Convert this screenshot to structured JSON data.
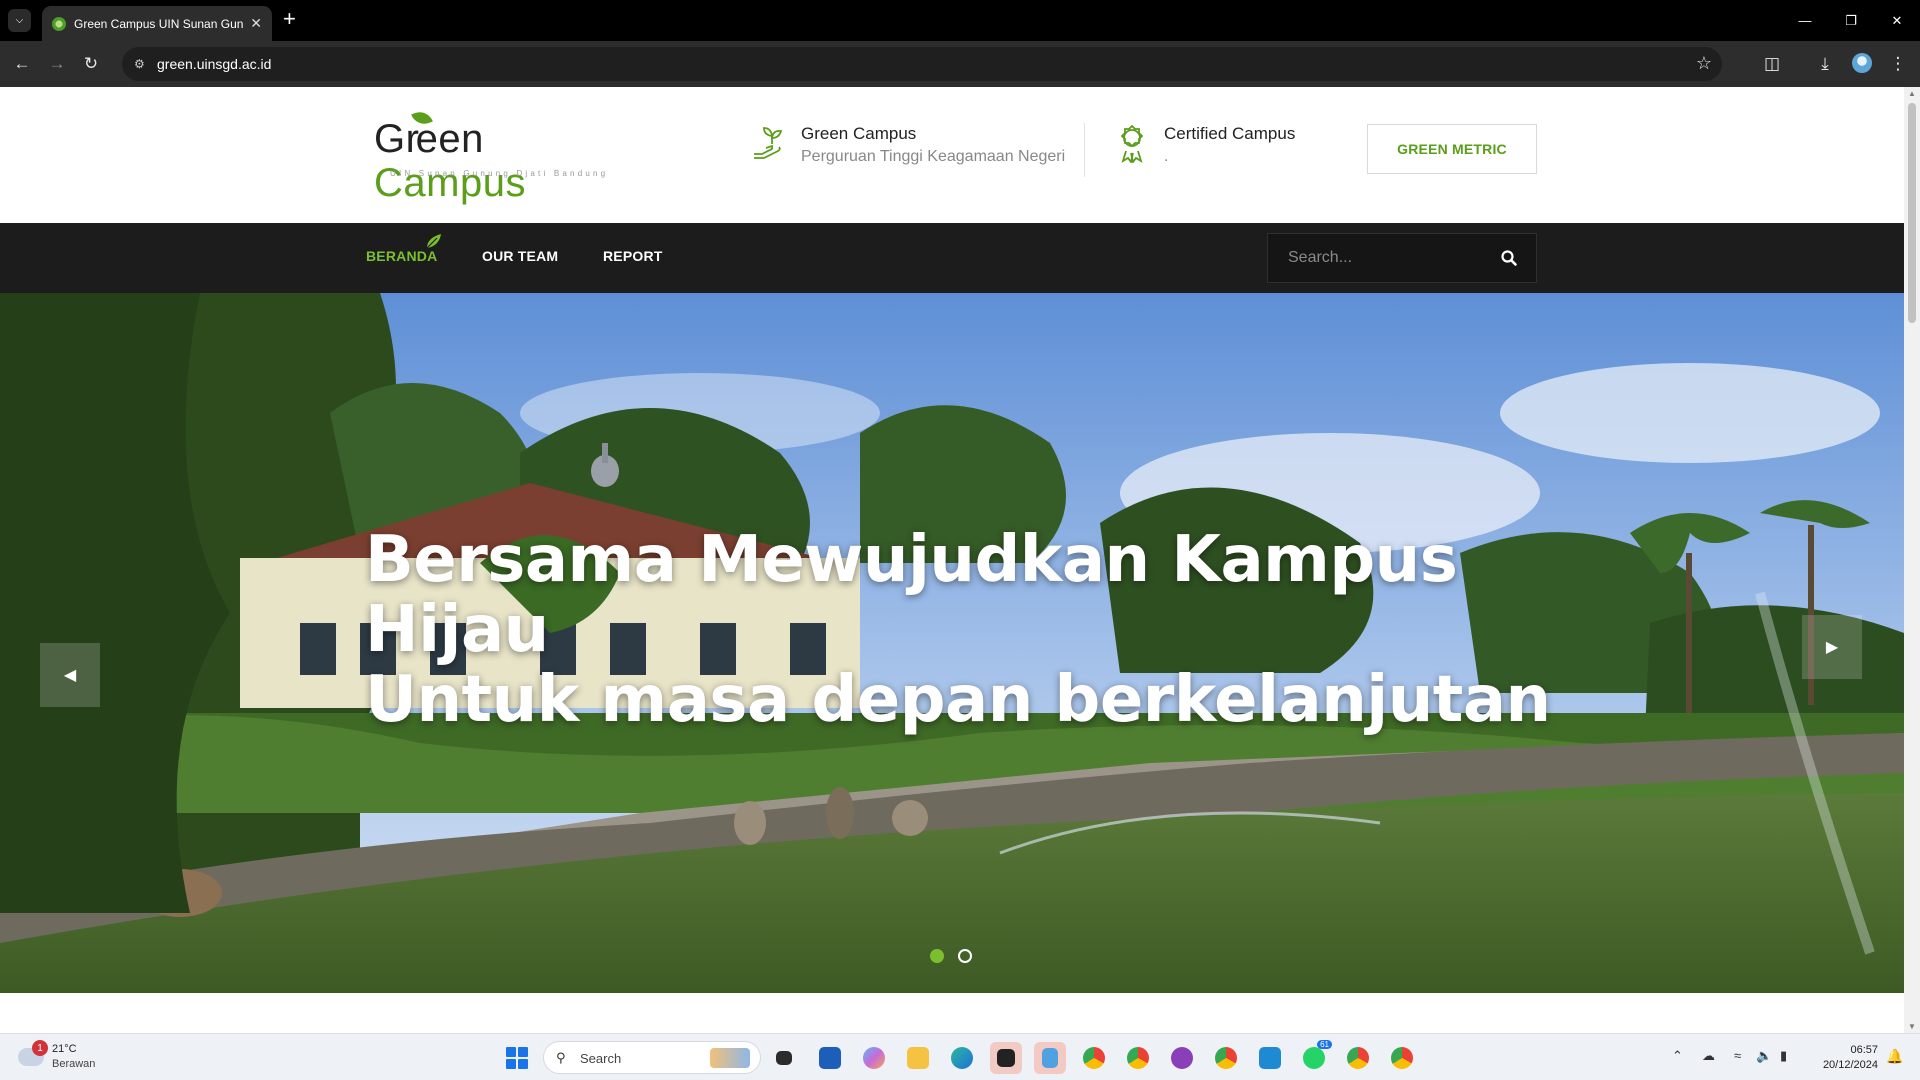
{
  "browser": {
    "tab_title": "Green Campus UIN Sunan Gunung Djati Bandung",
    "url": "green.uinsgd.ac.id"
  },
  "site": {
    "logo": {
      "word_dark": "G",
      "word_rest_dark": "een",
      "word_green": "Campus",
      "tagline": "UIN Sunan Gunung Djati Bandung"
    },
    "info_1": {
      "title": "Green Campus",
      "subtitle": "Perguruan Tinggi Keagamaan Negeri"
    },
    "info_2": {
      "title": "Certified Campus",
      "subtitle": "."
    },
    "cta_label": "GREEN METRIC",
    "nav": [
      {
        "label": "BERANDA",
        "active": true
      },
      {
        "label": "OUR TEAM",
        "active": false
      },
      {
        "label": "REPORT",
        "active": false
      }
    ],
    "search_placeholder": "Search...",
    "hero": {
      "line1": "Bersama Mewujudkan Kampus Hijau",
      "line2": "Untuk masa depan berkelanjutan",
      "slides": 2,
      "active_slide": 1
    },
    "accent_color": "#5a9e1a"
  },
  "taskbar": {
    "weather_temp": "21°C",
    "weather_cond": "Berawan",
    "weather_badge": "1",
    "search_label": "Search",
    "whatsapp_badge": "61",
    "time": "06:57",
    "date": "20/12/2024"
  }
}
